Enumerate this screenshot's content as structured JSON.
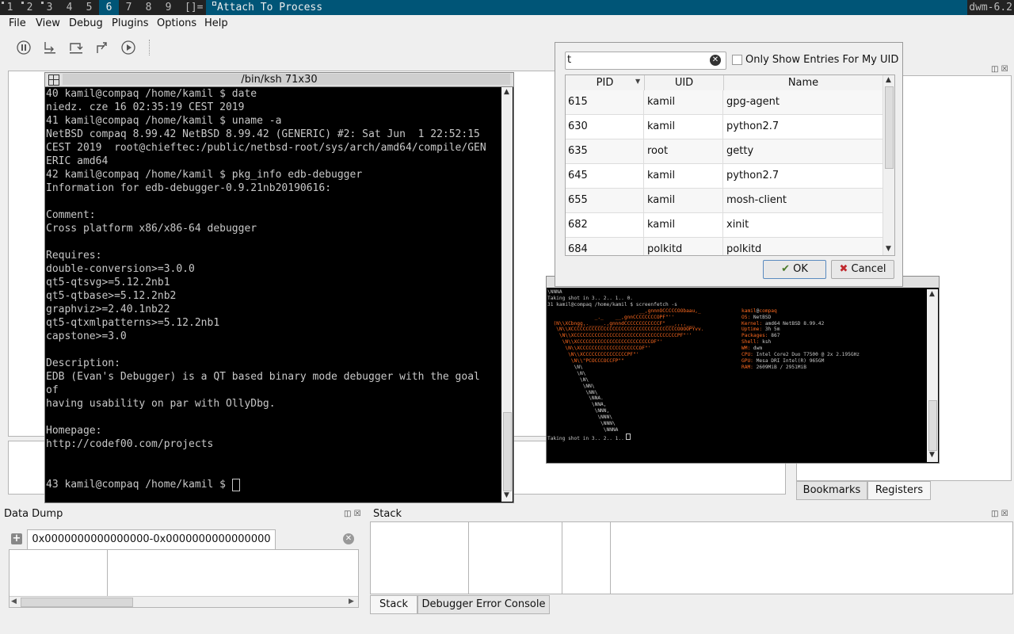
{
  "topbar": {
    "tags": [
      "1",
      "2",
      "3",
      "4",
      "5",
      "6",
      "7",
      "8",
      "9"
    ],
    "layout": "[]=",
    "window_title": "Attach To Process",
    "status": "dwm-6.2"
  },
  "menu": {
    "file": "File",
    "view": "View",
    "debug": "Debug",
    "plugins": "Plugins",
    "options": "Options",
    "help": "Help"
  },
  "terminal": {
    "title": "/bin/ksh 71x30",
    "lines": [
      "40 kamil@compaq /home/kamil $ date",
      "niedz. cze 16 02:35:19 CEST 2019",
      "41 kamil@compaq /home/kamil $ uname -a",
      "NetBSD compaq 8.99.42 NetBSD 8.99.42 (GENERIC) #2: Sat Jun  1 22:52:15",
      "CEST 2019  root@chieftec:/public/netbsd-root/sys/arch/amd64/compile/GEN",
      "ERIC amd64",
      "42 kamil@compaq /home/kamil $ pkg_info edb-debugger",
      "Information for edb-debugger-0.9.21nb20190616:",
      "",
      "Comment:",
      "Cross platform x86/x86-64 debugger",
      "",
      "Requires:",
      "double-conversion>=3.0.0",
      "qt5-qtsvg>=5.12.2nb1",
      "qt5-qtbase>=5.12.2nb2",
      "graphviz>=2.40.1nb22",
      "qt5-qtxmlpatterns>=5.12.2nb1",
      "capstone>=3.0",
      "",
      "Description:",
      "EDB (Evan's Debugger) is a QT based binary mode debugger with the goal",
      "of",
      "having usability on par with OllyDbg.",
      "",
      "Homepage:",
      "http://codef00.com/projects",
      "",
      "",
      "43 kamil@compaq /home/kamil $ "
    ]
  },
  "terminal2": {
    "top_lines": [
      "\\NNNA",
      "Taking shot in 3.. 2.. 1.. 0.",
      "31 kamil@compaq /home/kamil $ screenfetch -s"
    ],
    "art": [
      "                               __,gnnnOCCCCCOObaau,_",
      "                _._    __,gnnCCCCCCCCOPF\"''",
      "  (N\\\\XCbngg,._____.,gnnndCCCCCCCCCCCCF\"___,,,,___",
      "   \\N\\\\XCCCCCCCCCCCCCCCCCCCCCCCCCCCCCCCCCCCCOOOOPYvv.",
      "    \\N\\\\XCCCCCCCCCCCCCCCCCCCCCCCCCCCCCCCCCCCPF\"''",
      "     \\N\\\\XCCCCCCCCCCCCCCCCCCCCCCCCCOF\"'",
      "      \\N\\\\XCCCCCCCCCCCCCCCCCCCCOF\"'",
      "       \\N\\\\XCCCCCCCCCCCCCCCPF\"'",
      "        \\N\\\\\"PCOCCCOCCFP\"\"",
      "         \\N\\",
      "          \\N\\",
      "           \\N\\",
      "            \\NN\\",
      "             \\NN\\",
      "              \\NNA.",
      "               \\NNA,",
      "                \\NNN,",
      "                 \\NNN\\",
      "                  \\NNN\\",
      "                   \\NNNA"
    ],
    "user": "kamil",
    "host": "compaq",
    "info": [
      {
        "k": "OS:",
        "v": "NetBSD"
      },
      {
        "k": "Kernel:",
        "v": "amd64 NetBSD 8.99.42"
      },
      {
        "k": "Uptime:",
        "v": "3h 5m"
      },
      {
        "k": "Packages:",
        "v": "867"
      },
      {
        "k": "Shell:",
        "v": "ksh"
      },
      {
        "k": "WM:",
        "v": "dwm"
      },
      {
        "k": "CPU:",
        "v": "Intel Core2 Duo T7500 @ 2x 2.195GHz"
      },
      {
        "k": "GPU:",
        "v": "Mesa DRI Intel(R) 965GM"
      },
      {
        "k": "RAM:",
        "v": "2609MiB / 2951MiB"
      }
    ],
    "bottom_line": "Taking shot in 3.. 2.. 1.."
  },
  "dialog": {
    "search_value": "t",
    "checkbox_label": "Only Show Entries For My UID",
    "checkbox_checked": false,
    "columns": [
      "PID",
      "UID",
      "Name"
    ],
    "rows": [
      {
        "pid": "615",
        "uid": "kamil",
        "name": "gpg-agent"
      },
      {
        "pid": "630",
        "uid": "kamil",
        "name": "python2.7"
      },
      {
        "pid": "635",
        "uid": "root",
        "name": "getty"
      },
      {
        "pid": "645",
        "uid": "kamil",
        "name": "python2.7"
      },
      {
        "pid": "655",
        "uid": "kamil",
        "name": "mosh-client"
      },
      {
        "pid": "682",
        "uid": "kamil",
        "name": "xinit"
      },
      {
        "pid": "684",
        "uid": "polkitd",
        "name": "polkitd"
      }
    ],
    "ok": "OK",
    "cancel": "Cancel"
  },
  "right_tabs": {
    "bookmarks": "Bookmarks",
    "registers": "Registers"
  },
  "data_dump": {
    "title": "Data Dump",
    "tab": "0x0000000000000000-0x0000000000000000"
  },
  "stack": {
    "title": "Stack",
    "tab_stack": "Stack",
    "tab_console": "Debugger Error Console"
  }
}
